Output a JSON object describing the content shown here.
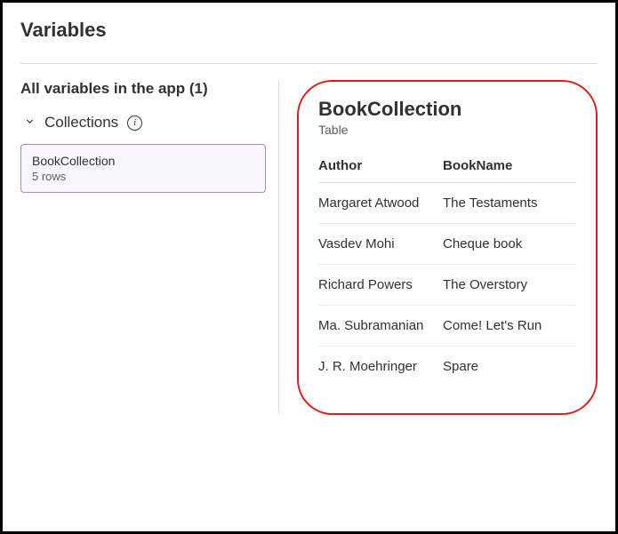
{
  "pageTitle": "Variables",
  "sidebar": {
    "heading": "All variables in the app (1)",
    "sectionLabel": "Collections",
    "card": {
      "name": "BookCollection",
      "rows": "5 rows"
    }
  },
  "detail": {
    "title": "BookCollection",
    "type": "Table",
    "columns": {
      "author": "Author",
      "bookName": "BookName"
    },
    "rows": [
      {
        "author": "Margaret Atwood",
        "bookName": "The Testaments"
      },
      {
        "author": "Vasdev Mohi",
        "bookName": "Cheque book"
      },
      {
        "author": "Richard Powers",
        "bookName": "The Overstory"
      },
      {
        "author": "Ma. Subramanian",
        "bookName": "Come! Let's Run"
      },
      {
        "author": "J. R. Moehringer",
        "bookName": "Spare"
      }
    ]
  }
}
